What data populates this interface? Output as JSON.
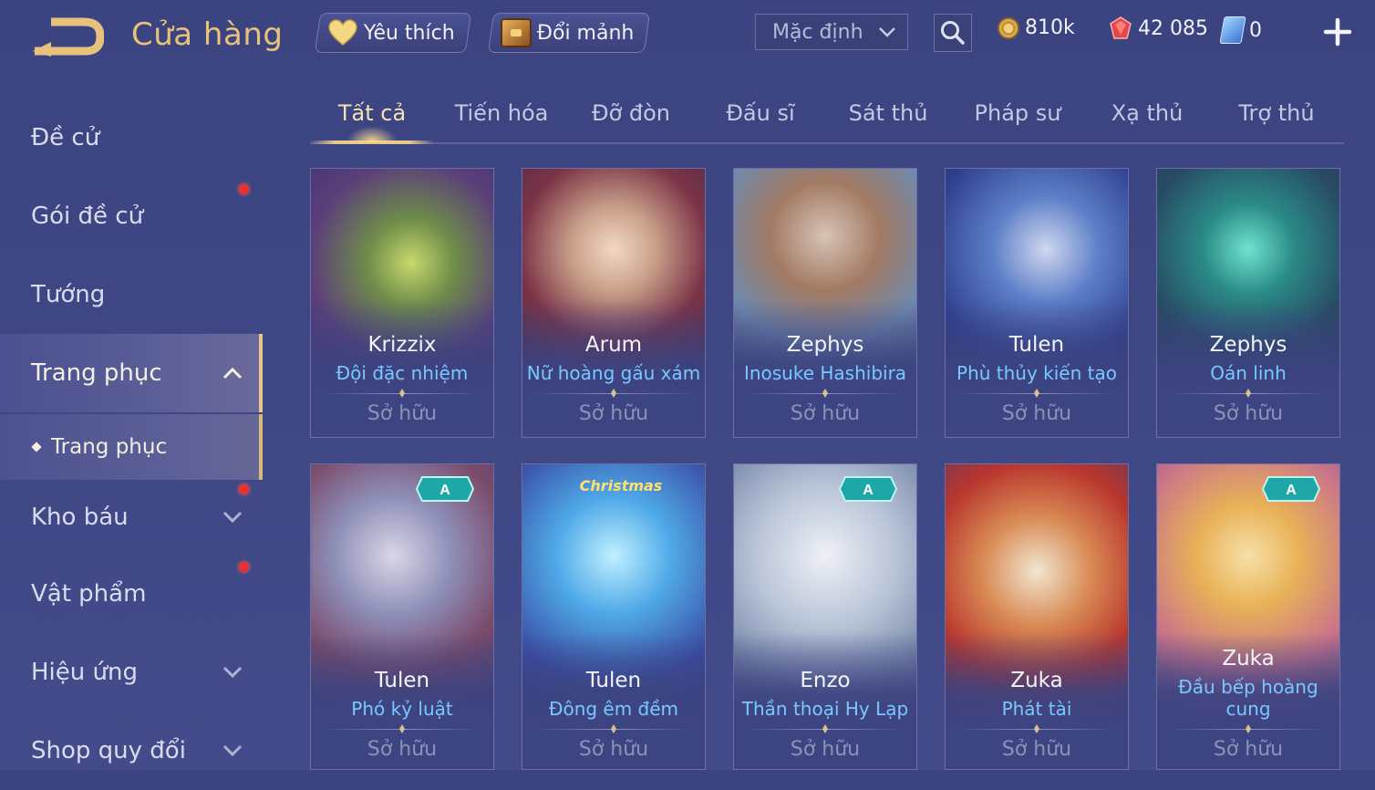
{
  "header": {
    "title": "Cửa hàng",
    "favorites_label": "Yêu thích",
    "trade_label": "Đổi mảnh",
    "sort_value": "Mặc định",
    "gold": "810k",
    "gems": "42 085",
    "vouchers": "0"
  },
  "sidebar": {
    "items": [
      {
        "label": "Đề cử"
      },
      {
        "label": "Gói đề cử"
      },
      {
        "label": "Tướng"
      },
      {
        "label": "Trang phục"
      },
      {
        "label": "Kho báu"
      },
      {
        "label": "Vật phẩm"
      },
      {
        "label": "Hiệu ứng"
      },
      {
        "label": "Shop quy đổi"
      }
    ],
    "sub_item": "Trang phục"
  },
  "tabs": [
    "Tất cả",
    "Tiến hóa",
    "Đỡ đòn",
    "Đấu sĩ",
    "Sát thủ",
    "Pháp sư",
    "Xạ thủ",
    "Trợ thủ"
  ],
  "cards": [
    {
      "hero": "Krizzix",
      "skin": "Đội đặc nhiệm",
      "status": "Sở hữu"
    },
    {
      "hero": "Arum",
      "skin": "Nữ hoàng gấu xám",
      "status": "Sở hữu"
    },
    {
      "hero": "Zephys",
      "skin": "Inosuke Hashibira",
      "status": "Sở hữu"
    },
    {
      "hero": "Tulen",
      "skin": "Phù thủy kiến tạo",
      "status": "Sở hữu"
    },
    {
      "hero": "Zephys",
      "skin": "Oán linh",
      "status": "Sở hữu"
    },
    {
      "hero": "Tulen",
      "skin": "Phó kỷ luật",
      "status": "Sở hữu",
      "badge": "A"
    },
    {
      "hero": "Tulen",
      "skin": "Đông êm đềm",
      "status": "Sở hữu",
      "badge": "Christmas"
    },
    {
      "hero": "Enzo",
      "skin": "Thần thoại Hy Lạp",
      "status": "Sở hữu",
      "badge": "A"
    },
    {
      "hero": "Zuka",
      "skin": "Phát tài",
      "status": "Sở hữu"
    },
    {
      "hero": "Zuka",
      "skin": "Đầu bếp hoàng cung",
      "status": "Sở hữu",
      "badge": "A"
    }
  ],
  "colors": {
    "background": "#3e4684",
    "title_gold": "#e8c27a",
    "skin_blue": "#79c8ff",
    "notification_red": "#e8312f"
  }
}
